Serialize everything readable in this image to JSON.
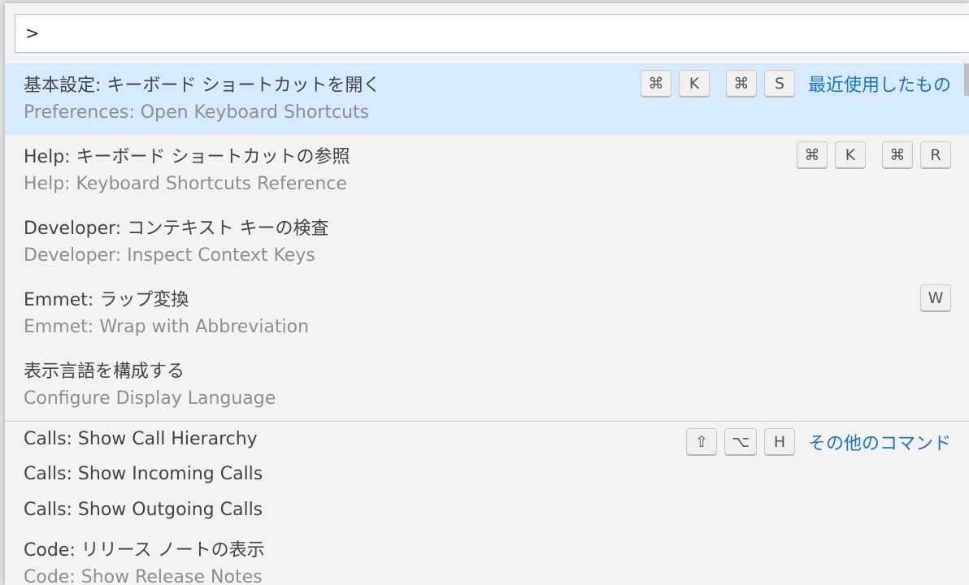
{
  "input": {
    "value": ">"
  },
  "items": [
    {
      "label": "基本設定: キーボード ショートカットを開く",
      "detail": "Preferences: Open Keyboard Shortcuts",
      "chords": [
        [
          "⌘",
          "K"
        ],
        [
          "⌘",
          "S"
        ]
      ],
      "tag": "最近使用したもの",
      "selected": true
    },
    {
      "label": "Help: キーボード ショートカットの参照",
      "detail": "Help: Keyboard Shortcuts Reference",
      "chords": [
        [
          "⌘",
          "K"
        ],
        [
          "⌘",
          "R"
        ]
      ]
    },
    {
      "label": "Developer: コンテキスト キーの検査",
      "detail": "Developer: Inspect Context Keys",
      "chords": []
    },
    {
      "label": "Emmet: ラップ変換",
      "detail": "Emmet: Wrap with Abbreviation",
      "chords": [
        [
          "W"
        ]
      ]
    },
    {
      "label": "表示言語を構成する",
      "detail": "Configure Display Language",
      "chords": []
    },
    {
      "label": "Calls: Show Call Hierarchy",
      "chords": [
        [
          "⇧",
          "⌥",
          "H"
        ]
      ],
      "tag": "その他のコマンド",
      "separator": true
    },
    {
      "label": "Calls: Show Incoming Calls",
      "chords": []
    },
    {
      "label": "Calls: Show Outgoing Calls",
      "chords": []
    },
    {
      "label": "Code: リリース ノートの表示",
      "detail": "Code: Show Release Notes",
      "chords": []
    }
  ],
  "colors": {
    "selected_bg": "#d6ebff",
    "tag": "#1a73c8",
    "input_border": "#89c4f4"
  }
}
